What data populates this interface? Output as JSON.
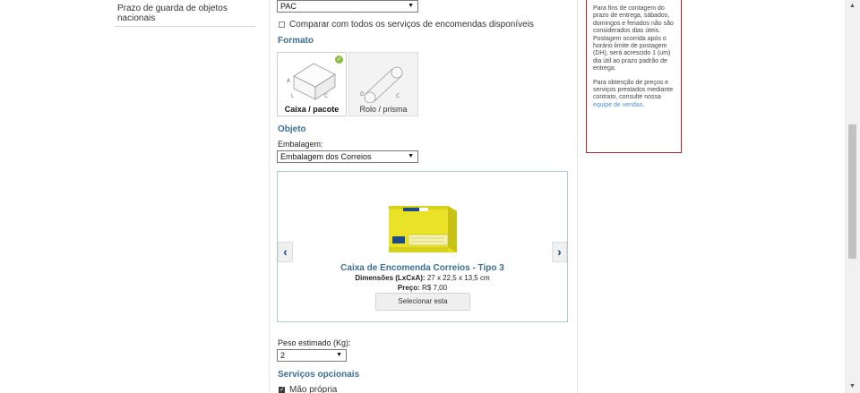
{
  "left_nav": {
    "item_label": "Prazo de guarda de objetos nacionais"
  },
  "service_select": {
    "value": "PAC"
  },
  "compare": {
    "label": "Comparar com todos os serviços de encomendas disponíveis"
  },
  "formato": {
    "title": "Formato",
    "options": [
      {
        "label": "Caixa / pacote",
        "selected": true
      },
      {
        "label": "Rolo / prisma",
        "selected": false
      }
    ]
  },
  "objeto": {
    "title": "Objeto",
    "embalagem_label": "Embalagem:",
    "embalagem_value": "Embalagem dos Correios"
  },
  "product": {
    "title": "Caixa de Encomenda Correios - Tipo 3",
    "dims_label": "Dimensões (LxCxA):",
    "dims_value": "27 x 22,5 x 13,5 cm",
    "price_label": "Preço:",
    "price_value": "R$ 7,00",
    "select_button": "Selecionar esta"
  },
  "peso": {
    "label": "Peso estimado (Kg):",
    "value": "2"
  },
  "servicos": {
    "title": "Serviços opcionais",
    "items": [
      {
        "label": "Mão própria",
        "checked": true
      }
    ]
  },
  "info": {
    "para1": "Para fins de contagem do prazo de entrega, sábados, domingos e feriados não são considerados dias úteis. Postagem ocorrida após o horário limite de postagem (DH), será acrescido 1 (um) dia útil ao prazo padrão de entrega.",
    "para2_text": "Para obtenção de preços e serviços prestados mediante contrato, consulte nossa",
    "para2_link": "equipe de vendas",
    "para2_end": "."
  },
  "icons": {
    "ok": "check-icon",
    "arrow_left": "chevron-left-icon",
    "arrow_right": "chevron-right-icon",
    "dropdown": "triangle-down-icon"
  },
  "colors": {
    "accent": "#3a6f96",
    "carousel_border": "#a9cccf",
    "info_border": "#b3262b",
    "box_yellow": "#e5de1f",
    "check_green": "#8cbf3f"
  }
}
